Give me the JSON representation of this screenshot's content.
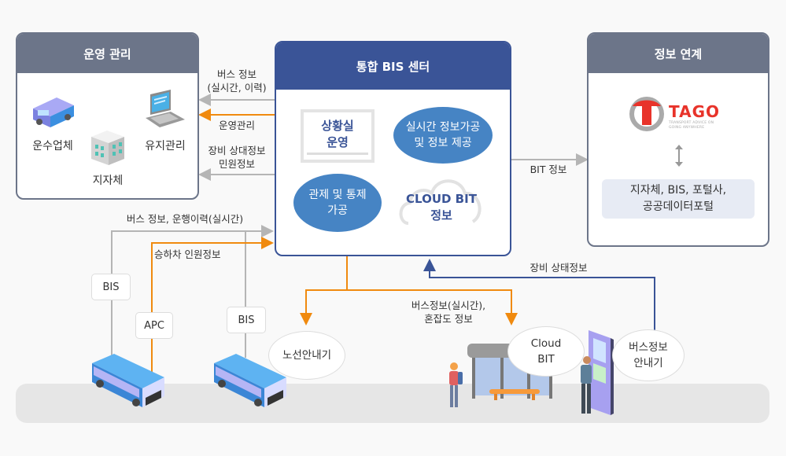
{
  "panels": {
    "operations": {
      "title": "운영 관리",
      "items": [
        {
          "label": "운수업체",
          "icon": "bus-icon"
        },
        {
          "label": "지자체",
          "icon": "building-icon"
        },
        {
          "label": "유지관리",
          "icon": "laptop-icon"
        }
      ]
    },
    "center": {
      "title": "통합 BIS 센터",
      "functions": {
        "situation_room": [
          "상황실",
          "운영"
        ],
        "realtime": [
          "실시간 정보가공",
          "및 정보 제공"
        ],
        "control": [
          "관제 및 통제",
          "가공"
        ],
        "cloud_bit": [
          "CLOUD BIT",
          "정보"
        ]
      }
    },
    "linkage": {
      "title": "정보 연계",
      "logo": {
        "name": "TAGO",
        "tagline": [
          "TRANSPORT ADVICE ON",
          "GOING ANYWHERE"
        ]
      },
      "partners": [
        "지자체, BIS, 포털사,",
        "공공데이터포털"
      ]
    }
  },
  "flows": {
    "bus_info": [
      "버스 정보",
      "(실시간, 이력)"
    ],
    "operation_mgmt": "운영관리",
    "equipment_complaint": [
      "장비 상대정보",
      "민원정보"
    ],
    "bit_info": "BIT 정보",
    "bus_history": "버스 정보, 운행이력(실시간)",
    "boarding_info": "승하차 인원정보",
    "equipment_status": "장비 상태정보",
    "bus_congestion": [
      "버스정보(실시간),",
      "혼잡도 정보"
    ]
  },
  "field": {
    "tags": {
      "bis_1": "BIS",
      "apc": "APC",
      "bis_2": "BIS"
    },
    "bubbles": {
      "route_guide": "노선안내기",
      "cloud_bit": [
        "Cloud",
        "BIT"
      ],
      "bus_info_guide": [
        "버스정보",
        "안내기"
      ]
    }
  },
  "colors": {
    "panel_header": "#6c7589",
    "center_header": "#3a5497",
    "ellipse": "#4684c4",
    "orange_flow": "#f08a0f",
    "gray_flow": "#b5b5b5",
    "blue_flow": "#3a5497",
    "tago_red": "#e8332a"
  }
}
